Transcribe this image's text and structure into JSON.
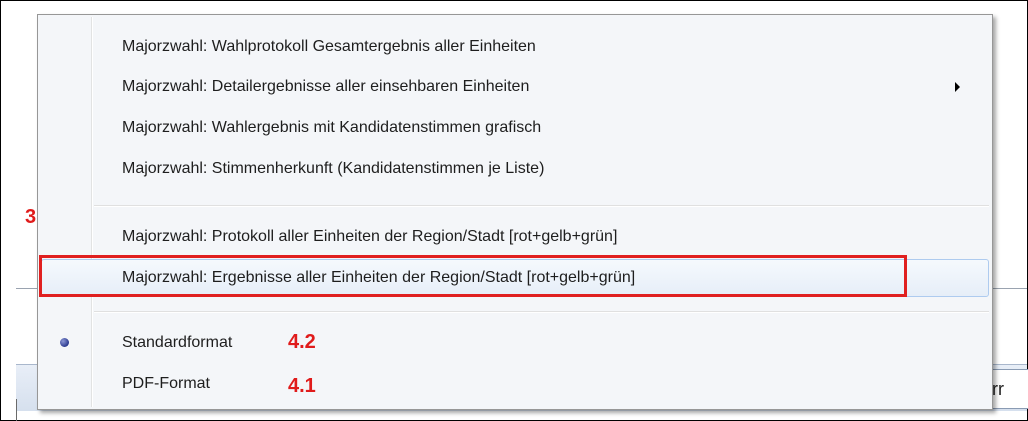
{
  "menu": {
    "items": [
      {
        "label": "Majorzwahl: Wahlprotokoll Gesamtergebnis aller Einheiten"
      },
      {
        "label": "Majorzwahl: Detailergebnisse aller einsehbaren Einheiten",
        "submenu": true
      },
      {
        "label": "Majorzwahl: Wahlergebnis mit Kandidatenstimmen grafisch"
      },
      {
        "label": "Majorzwahl: Stimmenherkunft (Kandidatenstimmen je Liste)"
      },
      {
        "label": "Majorzwahl: Protokoll aller Einheiten der Region/Stadt [rot+gelb+grün]"
      },
      {
        "label": "Majorzwahl: Ergebnisse aller Einheiten der Region/Stadt [rot+gelb+grün]",
        "highlighted": true
      }
    ],
    "format_options": [
      {
        "label": "Standardformat",
        "selected": true
      },
      {
        "label": "PDF-Format",
        "selected": false
      }
    ]
  },
  "annotations": {
    "step3": "3",
    "step4_2": "4.2",
    "step4_1": "4.1"
  },
  "background": {
    "field_text": "err"
  },
  "colors": {
    "annotation_red": "#e01b1b",
    "highlight_border": "#aecbef",
    "menu_background": "#f4f6f9"
  }
}
